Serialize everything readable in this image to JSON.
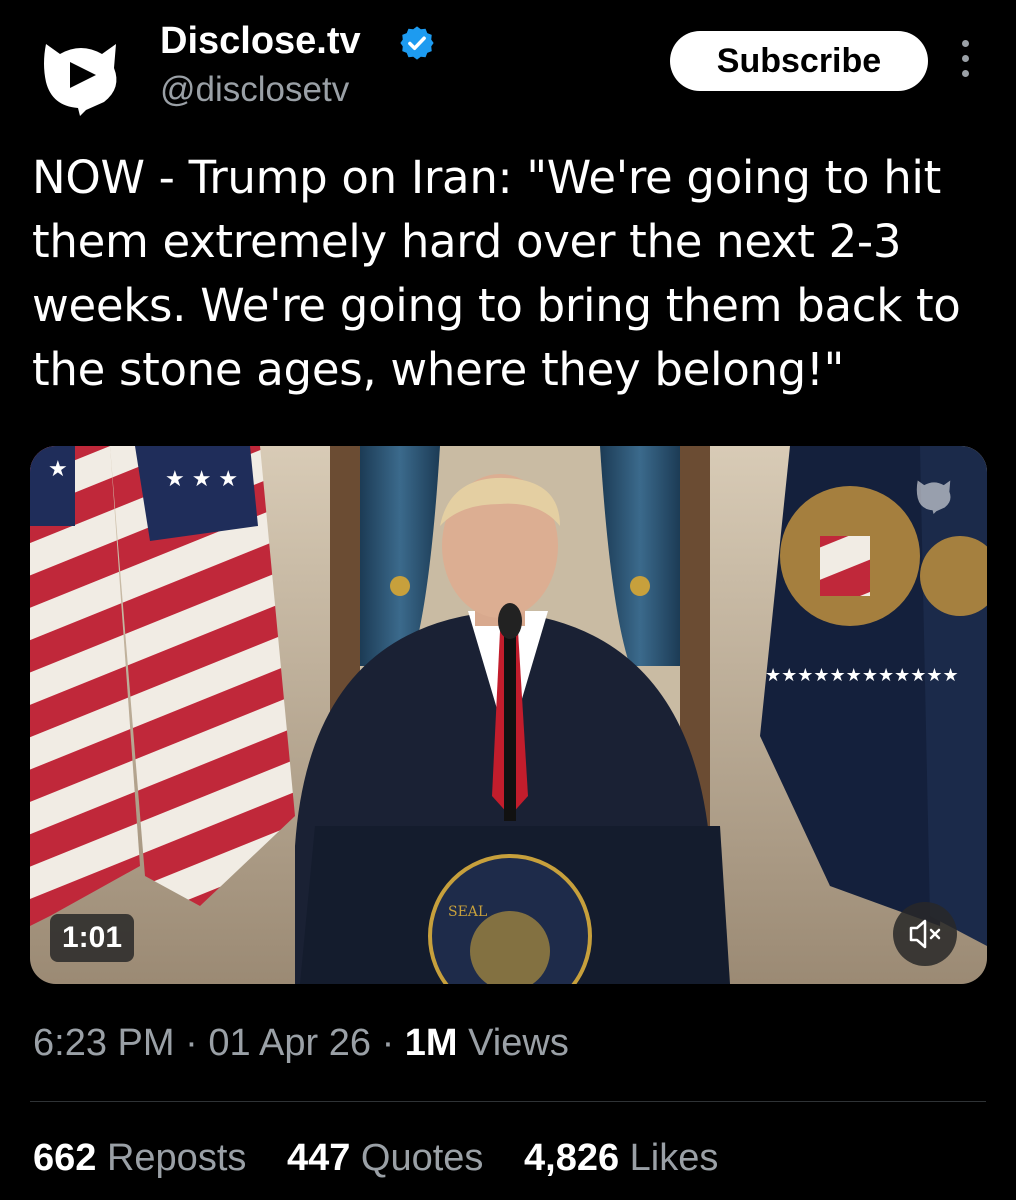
{
  "account": {
    "name": "Disclose.tv",
    "handle": "@disclosetv",
    "verified": true,
    "verified_color": "#1d9bf0"
  },
  "actions": {
    "subscribe_label": "Subscribe",
    "more_icon": "more-vertical-icon"
  },
  "tweet": {
    "text": "NOW - Trump on Iran: \"We're going to hit them extremely hard over the next 2-3 weeks. We're going to bring them back to the stone ages, where they belong!\""
  },
  "media": {
    "type": "video",
    "duration": "1:01",
    "muted": true,
    "mute_icon": "speaker-muted-icon"
  },
  "meta": {
    "time": "6:23 PM",
    "separator": "·",
    "date": "01 Apr 26",
    "views_count": "1M",
    "views_label": "Views"
  },
  "stats": {
    "reposts_count": "662",
    "reposts_label": "Reposts",
    "quotes_count": "447",
    "quotes_label": "Quotes",
    "likes_count": "4,826",
    "likes_label": "Likes"
  }
}
